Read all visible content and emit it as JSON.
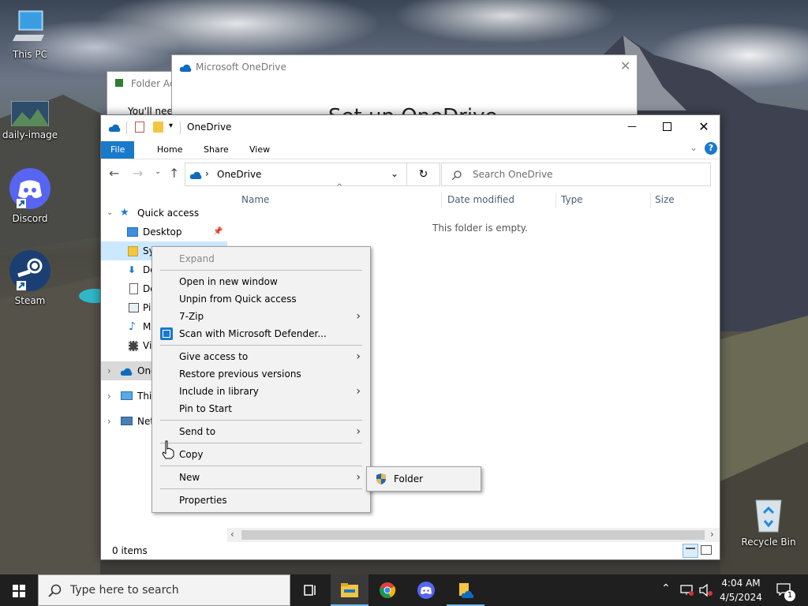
{
  "desktop": {
    "icons": [
      {
        "label": "This PC",
        "icon": "this-pc-icon"
      },
      {
        "label": "daily-image",
        "icon": "image-file-icon"
      },
      {
        "label": "Discord",
        "icon": "discord-icon"
      },
      {
        "label": "Steam",
        "icon": "steam-icon"
      },
      {
        "label": "Recycle Bin",
        "icon": "recycle-bin-icon"
      }
    ]
  },
  "background_windows": {
    "folder_access_title": "Folder Ac",
    "folder_access_text": "You'll nee",
    "onedrive_title": "Microsoft OneDrive",
    "onedrive_heading": "Set up OneDrive"
  },
  "explorer": {
    "title": "OneDrive",
    "ribbon_tabs": [
      "File",
      "Home",
      "Share",
      "View"
    ],
    "address_path": "OneDrive",
    "search_placeholder": "Search OneDrive",
    "columns": [
      "Name",
      "Date modified",
      "Type",
      "Size"
    ],
    "empty_message": "This folder is empty.",
    "status_items": "0 items",
    "nav": {
      "quick_access": "Quick access",
      "desktop": "Desktop",
      "sys": "Sy",
      "downloads": "Do",
      "documents": "Do",
      "pictures": "Pi",
      "music": "M",
      "videos": "Vi",
      "onedrive": "One",
      "this_pc": "This",
      "network": "Net"
    }
  },
  "context_menu": {
    "items": {
      "expand": "Expand",
      "open_new_window": "Open in new window",
      "unpin": "Unpin from Quick access",
      "seven_zip": "7-Zip",
      "scan": "Scan with Microsoft Defender...",
      "give_access": "Give access to",
      "restore": "Restore previous versions",
      "include_library": "Include in library",
      "pin_start": "Pin to Start",
      "send_to": "Send to",
      "copy": "Copy",
      "new": "New",
      "properties": "Properties"
    },
    "submenu_folder": "Folder"
  },
  "taskbar": {
    "search_placeholder": "Type here to search",
    "time": "4:04 AM",
    "date": "4/5/2024",
    "notification_count": "1"
  },
  "colors": {
    "accent": "#1979ca",
    "onedrive_blue": "#0f6cbd",
    "folder_yellow": "#f4c542",
    "taskbar": "#1f1f1f"
  }
}
